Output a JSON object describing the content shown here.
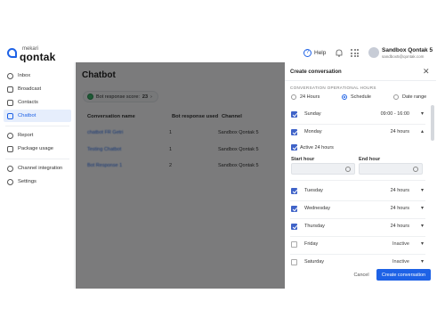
{
  "brand": {
    "small": "mekari",
    "name": "qontak"
  },
  "header": {
    "help_label": "Help",
    "user_name": "Sandbox Qontak 5",
    "user_email": "sandbox5@qontak.com"
  },
  "sidebar": {
    "items": [
      {
        "label": "Inbox"
      },
      {
        "label": "Broadcast"
      },
      {
        "label": "Contacts"
      },
      {
        "label": "Chatbot"
      },
      {
        "label": "Report"
      },
      {
        "label": "Package usage"
      },
      {
        "label": "Channel integration"
      },
      {
        "label": "Settings"
      }
    ],
    "active": "Chatbot"
  },
  "main": {
    "title": "Chatbot",
    "score_label": "Bot response score:",
    "score_value": "23",
    "columns": [
      "Conversation name",
      "Bot response used",
      "Channel"
    ],
    "rows": [
      {
        "name": "chatbot FR Getri",
        "used": "1",
        "channel": "Sandbox Qontak 5"
      },
      {
        "name": "Testing Chatbot",
        "used": "1",
        "channel": "Sandbox Qontak 5"
      },
      {
        "name": "Bot Response 1",
        "used": "2",
        "channel": "Sandbox Qontak 5"
      }
    ]
  },
  "drawer": {
    "title": "Create conversation",
    "section_label": "CONVERSATION OPERATIONAL HOURS",
    "radios": [
      {
        "label": "24 Hours",
        "selected": false
      },
      {
        "label": "Schedule",
        "selected": true
      },
      {
        "label": "Date range",
        "selected": false
      }
    ],
    "days": [
      {
        "name": "Sunday",
        "value": "09:00 - 16:00",
        "checked": true
      },
      {
        "name": "Monday",
        "value": "24 hours",
        "checked": true
      },
      {
        "name": "Tuesday",
        "value": "24 hours",
        "checked": true
      },
      {
        "name": "Wednesday",
        "value": "24 hours",
        "checked": true
      },
      {
        "name": "Thursday",
        "value": "24 hours",
        "checked": true
      },
      {
        "name": "Friday",
        "value": "Inactive",
        "checked": false
      },
      {
        "name": "Saturday",
        "value": "Inactive",
        "checked": false
      }
    ],
    "active24_label": "Active 24 hours",
    "start_hour_label": "Start hour",
    "end_hour_label": "End hour",
    "cancel_label": "Cancel",
    "create_label": "Create conversation"
  }
}
